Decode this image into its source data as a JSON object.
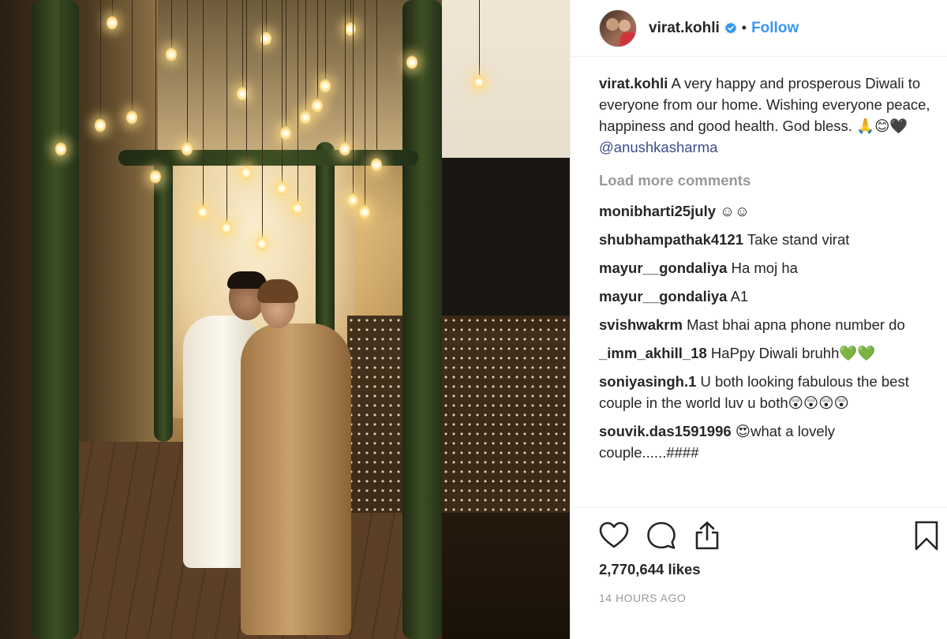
{
  "post": {
    "username": "virat.kohli",
    "follow_label": "Follow",
    "separator": "•",
    "verified_icon": "verified-badge-icon",
    "accent_color": "#3897f0"
  },
  "caption": {
    "username": "virat.kohli",
    "text": "A very happy and prosperous Diwali to everyone from our home. Wishing everyone peace, happiness and good health. God bless.",
    "emojis": "🙏😊🖤",
    "mention": "@anushkasharma"
  },
  "load_more": "Load more comments",
  "comments": [
    {
      "user": "monibharti25july",
      "text": "☺☺"
    },
    {
      "user": "shubhampathak4121",
      "text": "Take stand virat"
    },
    {
      "user": "mayur__gondaliya",
      "text": "Ha moj ha"
    },
    {
      "user": "mayur__gondaliya",
      "text": "A1"
    },
    {
      "user": "svishwakrm",
      "text": "Mast bhai apna phone number do"
    },
    {
      "user": "_imm_akhill_18",
      "text": "HaPpy Diwali bruhh💚💚"
    },
    {
      "user": "soniyasingh.1",
      "text": "U both looking fabulous the best couple in the world luv u both😲😲😲😲"
    },
    {
      "user": "souvik.das1591996",
      "text": "😍what a lovely couple......####"
    }
  ],
  "actions": {
    "like_icon": "heart-icon",
    "comment_icon": "comment-bubble-icon",
    "share_icon": "share-icon",
    "save_icon": "bookmark-icon"
  },
  "likes": "2,770,644 likes",
  "timestamp": "14 HOURS AGO"
}
